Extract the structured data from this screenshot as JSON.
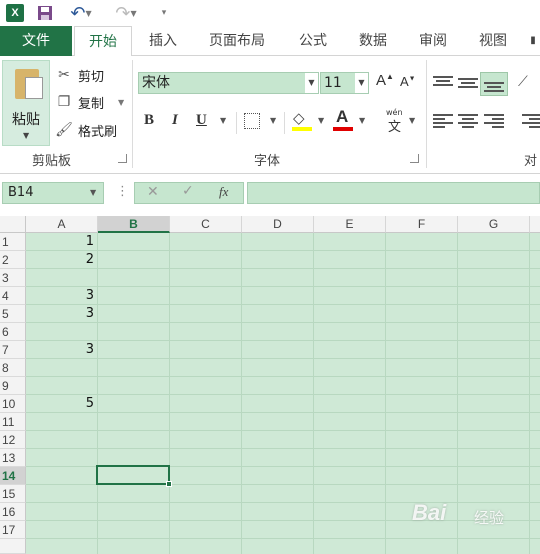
{
  "quick_access": {
    "logo": "X",
    "save_icon": "save-icon",
    "undo_icon": "undo-icon",
    "redo_icon": "redo-icon"
  },
  "tabs": [
    {
      "label": "文件"
    },
    {
      "label": "开始"
    },
    {
      "label": "插入"
    },
    {
      "label": "页面布局"
    },
    {
      "label": "公式"
    },
    {
      "label": "数据"
    },
    {
      "label": "审阅"
    },
    {
      "label": "视图"
    }
  ],
  "clipboard": {
    "paste": "粘贴",
    "cut": "剪切",
    "copy": "复制",
    "format_painter": "格式刷",
    "group_label": "剪贴板"
  },
  "font": {
    "name": "宋体",
    "size": "11",
    "group_label": "字体",
    "bold": "B",
    "italic": "I",
    "underline": "U",
    "font_color_glyph": "A",
    "phonetic_top": "wén",
    "phonetic_bottom": "文"
  },
  "alignment": {
    "group_label": "对"
  },
  "formula_bar": {
    "name_box": "B14",
    "value": ""
  },
  "columns": [
    "A",
    "B",
    "C",
    "D",
    "E",
    "F",
    "G"
  ],
  "selected_column": "B",
  "rows": [
    "1",
    "2",
    "3",
    "4",
    "5",
    "6",
    "7",
    "8",
    "9",
    "10",
    "11",
    "12",
    "13",
    "14",
    "15",
    "16",
    "17"
  ],
  "selected_row": "14",
  "column_a_values": [
    "1",
    "2",
    "",
    "3",
    "3",
    "",
    "3",
    "",
    "",
    "5",
    "",
    "",
    "",
    "",
    "",
    "",
    ""
  ],
  "colors": {
    "accent": "#217346",
    "cell_fill": "#cfe9d6"
  },
  "watermark": {
    "brand": "Bai",
    "suffix": "经验"
  }
}
